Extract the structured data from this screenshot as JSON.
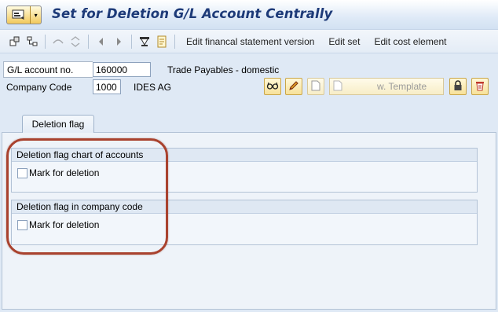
{
  "window": {
    "title": "Set for Deletion G/L Account Centrally"
  },
  "toolbar": {
    "buttons": [
      {
        "icon": "other-object-icon"
      },
      {
        "icon": "hierarchy-icon"
      },
      {
        "icon": "display-change-icon"
      },
      {
        "icon": "switch-icon"
      },
      {
        "icon": "previous-icon"
      },
      {
        "icon": "next-icon"
      },
      {
        "icon": "where-used-icon"
      },
      {
        "icon": "info-icon"
      }
    ],
    "links": [
      "Edit financal statement version",
      "Edit set",
      "Edit cost element"
    ]
  },
  "header": {
    "gl_account": {
      "label": "G/L account no.",
      "value": "160000",
      "description": "Trade Payables - domestic"
    },
    "company_code": {
      "label": "Company Code",
      "value": "1000",
      "description": "IDES AG"
    },
    "template_button": "w. Template"
  },
  "tabs": [
    {
      "label": "Deletion flag"
    }
  ],
  "groups": {
    "chart_of_accounts": {
      "title": "Deletion flag chart of accounts",
      "checkbox_label": "Mark for deletion",
      "checked": false
    },
    "company_code": {
      "title": "Deletion flag in company code",
      "checkbox_label": "Mark for deletion",
      "checked": false
    }
  },
  "colors": {
    "title_text": "#1d3a78",
    "background": "#dfe9f5",
    "highlight": "#a9422e"
  }
}
